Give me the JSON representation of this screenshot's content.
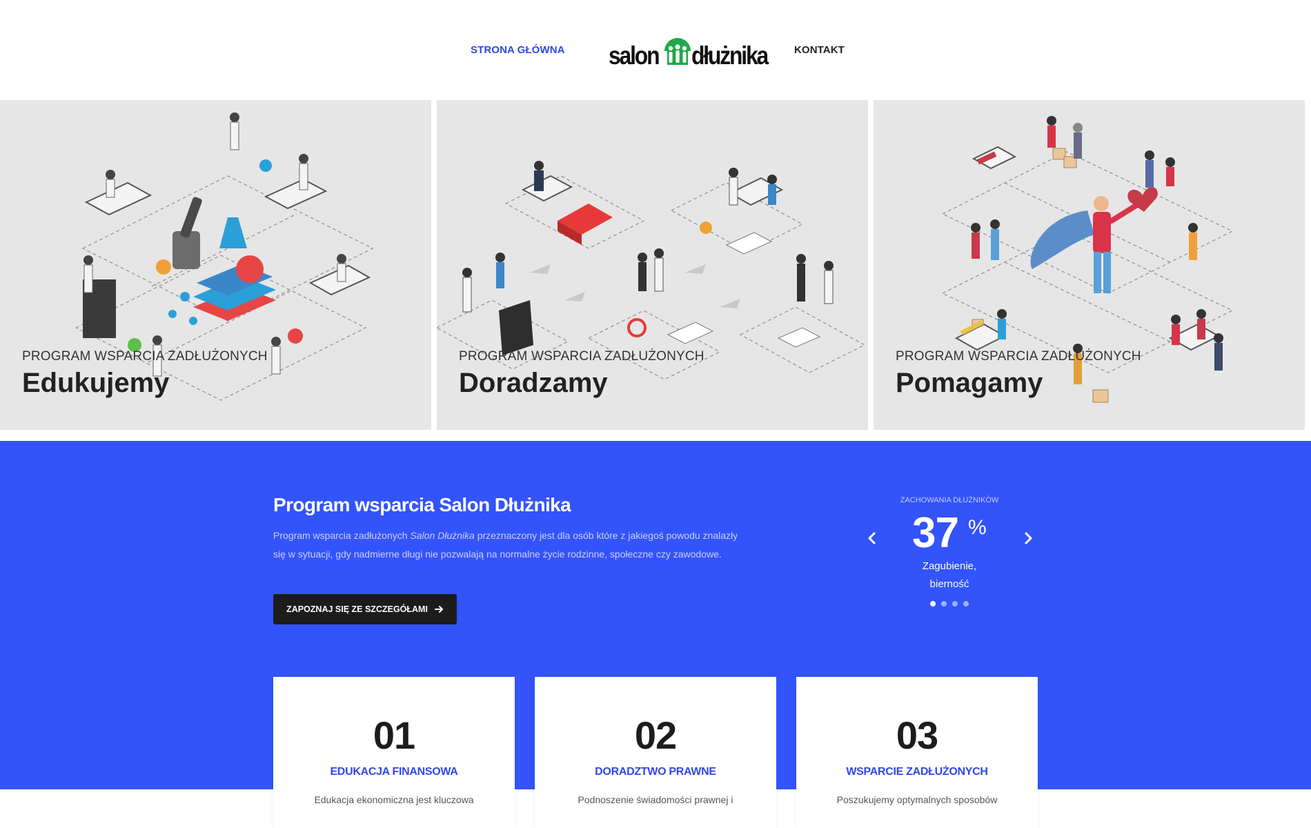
{
  "nav": {
    "home": "STRONA GŁÓWNA",
    "contact": "KONTAKT",
    "logo_part1": "salon",
    "logo_part2": "dłużnika"
  },
  "tiles": [
    {
      "kicker": "PROGRAM WSPARCIA ZADŁUŻONYCH",
      "title": "Edukujemy"
    },
    {
      "kicker": "PROGRAM WSPARCIA ZADŁUŻONYCH",
      "title": "Doradzamy"
    },
    {
      "kicker": "PROGRAM WSPARCIA ZADŁUŻONYCH",
      "title": "Pomagamy"
    }
  ],
  "program": {
    "title": "Program wsparcia Salon Dłużnika",
    "desc_before": "Program wsparcia zadłużonych ",
    "desc_em": "Salon Dłużnika",
    "desc_after": " przeznaczony jest dla osób które z jakiegoś powodu znalazły się w sytuacji, gdy nadmierne długi nie pozwalają na normalne życie rodzinne, społeczne czy zawodowe.",
    "cta": "ZAPOZNAJ SIĘ ZE SZCZEGÓŁAMI"
  },
  "stat": {
    "label": "ZACHOWANIA DŁUŻNIKÓW",
    "value": "37",
    "unit": "%",
    "caption": "Zagubienie, bierność",
    "slide_count": 4,
    "active_slide": 1
  },
  "cards": [
    {
      "num": "01",
      "title": "EDUKACJA FINANSOWA",
      "text": "Edukacja ekonomiczna jest kluczowa"
    },
    {
      "num": "02",
      "title": "DORADZTWO PRAWNE",
      "text": "Podnoszenie świadomości prawnej i"
    },
    {
      "num": "03",
      "title": "WSPARCIE ZADŁUŻONYCH",
      "text": "Poszukujemy optymalnych sposobów"
    }
  ],
  "colors": {
    "accent_blue": "#3353fb",
    "nav_active": "#2f48e8",
    "logo_green": "#1ea84a",
    "dark_button": "#1c1c1c",
    "tile_bg": "#e6e6e6"
  },
  "icons": [
    "chevron-left-icon",
    "chevron-right-icon",
    "arrow-right-icon"
  ]
}
